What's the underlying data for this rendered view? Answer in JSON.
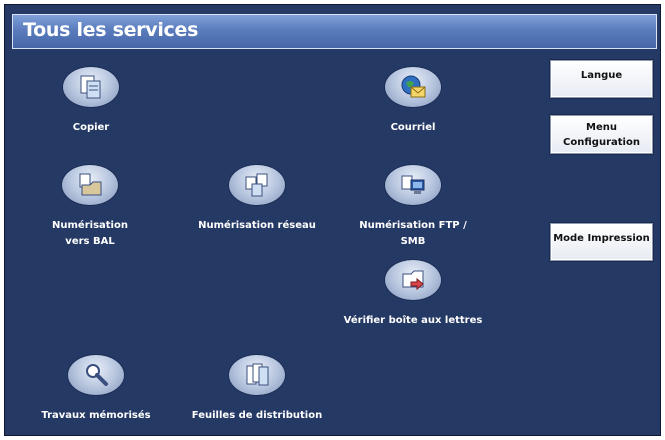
{
  "header": {
    "title": "Tous les services"
  },
  "services": [
    {
      "label": "Copier",
      "icon": "copy-icon"
    },
    {
      "label": "Courriel",
      "icon": "email-icon"
    },
    {
      "label": "Numérisation vers BAL",
      "icon": "scan-to-mailbox-icon"
    },
    {
      "label": "Numérisation réseau",
      "icon": "network-scan-icon"
    },
    {
      "label": "Numérisation FTP / SMB",
      "icon": "ftp-smb-scan-icon"
    },
    {
      "label": "Vérifier boîte aux lettres",
      "icon": "check-mailbox-icon"
    },
    {
      "label": "Travaux mémorisés",
      "icon": "stored-jobs-icon"
    },
    {
      "label": "Feuilles de distribution",
      "icon": "distribution-sheets-icon"
    }
  ],
  "side_buttons": {
    "language": "Langue",
    "menu_line1": "Menu",
    "menu_line2": "Configuration",
    "print_mode": "Mode Impression"
  },
  "colors": {
    "background": "#253965",
    "title_bar": "#5a7cbd",
    "button": "#ffffff"
  }
}
